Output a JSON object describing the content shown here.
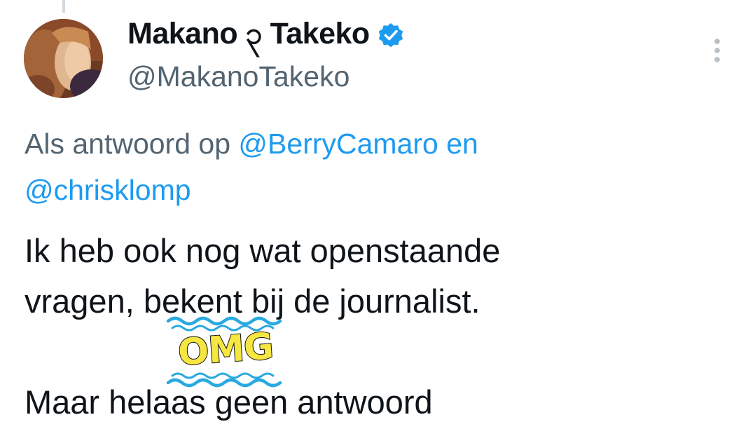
{
  "author": {
    "display_name": "Makano ၃ Takeko",
    "handle": "@MakanoTakeko",
    "verified_icon": "verified-badge-icon",
    "avatar_icon": "avatar-photo"
  },
  "reply_context": {
    "prefix": "Als antwoord op",
    "mention_1": "@BerryCamaro",
    "joiner": "en",
    "mention_2": "@chrisklomp"
  },
  "tweet": {
    "line_1": "Ik heb ook nog wat openstaande",
    "line_2": "vragen, bekent bij de journalist.",
    "line_3": "Maar helaas geen antwoord"
  },
  "sticker": {
    "label": "OMG"
  },
  "menu": {
    "icon": "more-vertical-icon"
  },
  "colors": {
    "accent": "#1d9bf0",
    "secondary_text": "#536471",
    "primary_text": "#0f1419",
    "sticker_fill": "#f5e642",
    "sticker_waves": "#29a9e0"
  }
}
